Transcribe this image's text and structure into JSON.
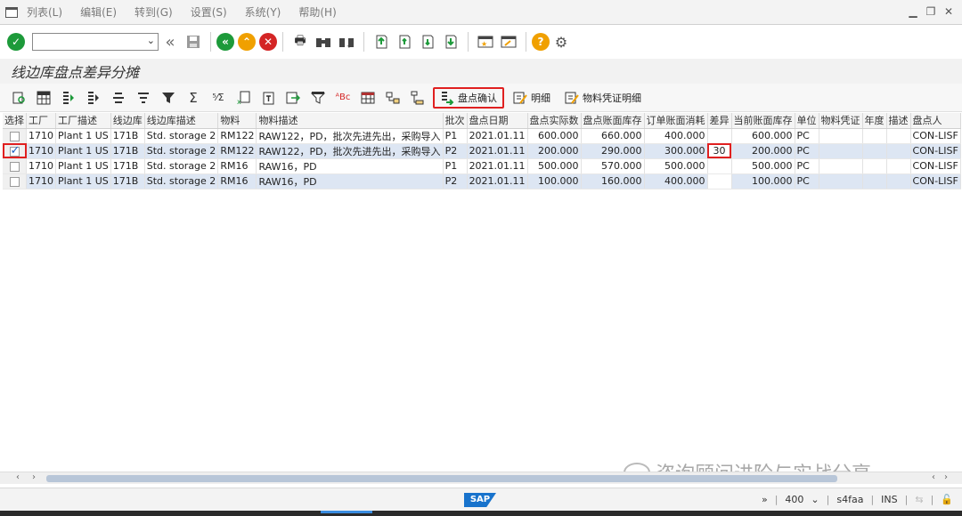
{
  "menu": [
    "列表(L)",
    "编辑(E)",
    "转到(G)",
    "设置(S)",
    "系统(Y)",
    "帮助(H)"
  ],
  "title": "线边库盘点差异分摊",
  "app_toolbar": {
    "confirm_label": "盘点确认",
    "detail_label": "明细",
    "doc_detail_label": "物料凭证明细"
  },
  "table": {
    "headers": [
      "选择",
      "工厂",
      "工厂描述",
      "线边库",
      "线边库描述",
      "物料",
      "物料描述",
      "批次",
      "盘点日期",
      "盘点实际数",
      "盘点账面库存",
      "订单账面消耗",
      "差异",
      "当前账面库存",
      "单位",
      "物料凭证",
      "年度",
      "描述",
      "盘点人"
    ],
    "rows": [
      {
        "selected": false,
        "plant": "1710",
        "plant_desc": "Plant 1 US",
        "sloc": "171B",
        "sloc_desc": "Std. storage 2",
        "material": "RM122",
        "mat_desc": "RAW122，PD，批次先进先出，采购导入",
        "batch": "P1",
        "date": "2021.01.11",
        "actual": "600.000",
        "book": "660.000",
        "consumed": "400.000",
        "diff": "",
        "current": "600.000",
        "unit": "PC",
        "doc": "",
        "year": "",
        "desc": "",
        "counter": "CON-LISF"
      },
      {
        "selected": true,
        "plant": "1710",
        "plant_desc": "Plant 1 US",
        "sloc": "171B",
        "sloc_desc": "Std. storage 2",
        "material": "RM122",
        "mat_desc": "RAW122，PD，批次先进先出，采购导入",
        "batch": "P2",
        "date": "2021.01.11",
        "actual": "200.000",
        "book": "290.000",
        "consumed": "300.000",
        "diff": "30",
        "current": "200.000",
        "unit": "PC",
        "doc": "",
        "year": "",
        "desc": "",
        "counter": "CON-LISF"
      },
      {
        "selected": false,
        "plant": "1710",
        "plant_desc": "Plant 1 US",
        "sloc": "171B",
        "sloc_desc": "Std. storage 2",
        "material": "RM16",
        "mat_desc": "RAW16，PD",
        "batch": "P1",
        "date": "2021.01.11",
        "actual": "500.000",
        "book": "570.000",
        "consumed": "500.000",
        "diff": "",
        "current": "500.000",
        "unit": "PC",
        "doc": "",
        "year": "",
        "desc": "",
        "counter": "CON-LISF"
      },
      {
        "selected": false,
        "plant": "1710",
        "plant_desc": "Plant 1 US",
        "sloc": "171B",
        "sloc_desc": "Std. storage 2",
        "material": "RM16",
        "mat_desc": "RAW16，PD",
        "batch": "P2",
        "date": "2021.01.11",
        "actual": "100.000",
        "book": "160.000",
        "consumed": "400.000",
        "diff": "",
        "current": "100.000",
        "unit": "PC",
        "doc": "",
        "year": "",
        "desc": "",
        "counter": "CON-LISF"
      }
    ]
  },
  "status": {
    "client": "400",
    "system": "s4faa",
    "mode": "INS"
  },
  "watermark": "咨询顾问进阶与实战分享",
  "sap_logo": "SAP",
  "colors": {
    "highlight": "#e02020",
    "row_alt": "#dde6f3",
    "ok_green": "#1d9a3a",
    "nav_orange": "#f0a000",
    "cancel_red": "#d42525"
  }
}
